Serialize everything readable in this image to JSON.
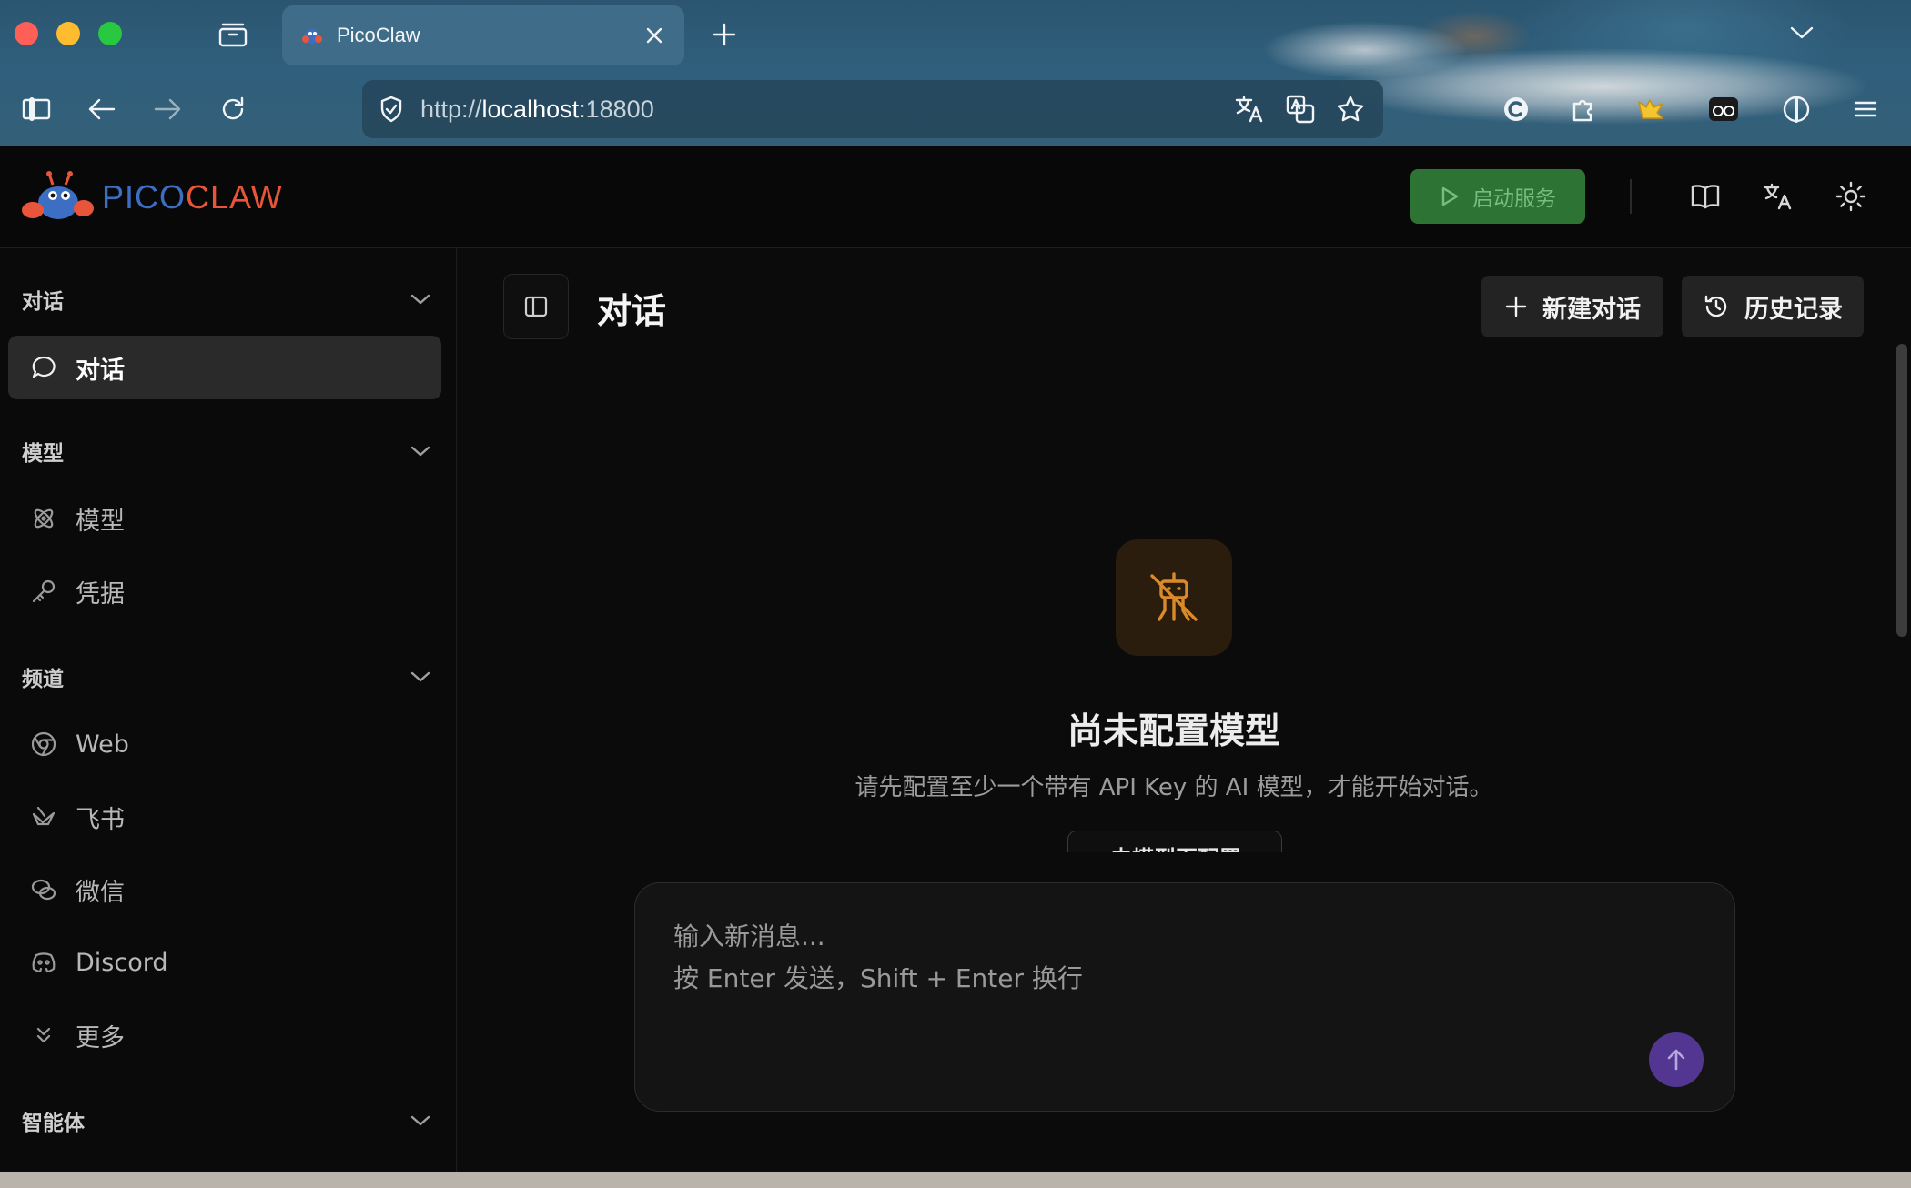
{
  "browser": {
    "tab_title": "PicoClaw",
    "url_scheme": "http://",
    "url_host": "localhost",
    "url_port": ":18800"
  },
  "header": {
    "logo_pico": "PICO",
    "logo_claw": "CLAW",
    "start_button": "启动服务"
  },
  "sidebar": {
    "sections": [
      {
        "title": "对话",
        "items": [
          {
            "label": "对话",
            "icon": "chat-bubble-icon",
            "active": true
          }
        ]
      },
      {
        "title": "模型",
        "items": [
          {
            "label": "模型",
            "icon": "atom-icon"
          },
          {
            "label": "凭据",
            "icon": "key-icon"
          }
        ]
      },
      {
        "title": "频道",
        "items": [
          {
            "label": "Web",
            "icon": "chrome-icon"
          },
          {
            "label": "飞书",
            "icon": "feishu-icon"
          },
          {
            "label": "微信",
            "icon": "wechat-icon"
          },
          {
            "label": "Discord",
            "icon": "discord-icon"
          },
          {
            "label": "更多",
            "icon": "chevrons-down-icon"
          }
        ]
      },
      {
        "title": "智能体",
        "items": []
      }
    ]
  },
  "main": {
    "title": "对话",
    "new_chat": "新建对话",
    "history": "历史记录",
    "empty_title": "尚未配置模型",
    "empty_desc": "请先配置至少一个带有 API Key 的 AI 模型，才能开始对话。",
    "goto_button": "去模型页配置",
    "composer_placeholder": "输入新消息...\n按 Enter 发送，Shift + Enter 换行"
  },
  "colors": {
    "accent_green": "#2f7a37",
    "send_purple": "#5a3aa0",
    "empty_icon_orange": "#d98a2b",
    "logo_blue": "#3c6ec4",
    "logo_red": "#e8553a"
  }
}
